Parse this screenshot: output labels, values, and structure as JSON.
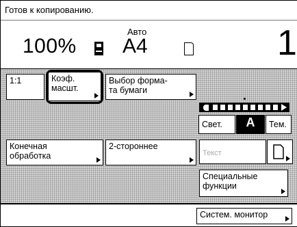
{
  "status": {
    "text": "Готов к копированию."
  },
  "header": {
    "zoom": "100%",
    "paper_mode": "Авто",
    "paper_size": "A4",
    "copies": "1"
  },
  "buttons": {
    "ratio_1to1": "1:1",
    "zoom_coef": "Коэф.\nмасшт.",
    "paper_select": "Выбор форма-\nта бумаги",
    "finishing": "Конечная\nобработка",
    "duplex": "2-стороннее",
    "special": "Специальные\nфункции",
    "sys_monitor": "Систем. монитор"
  },
  "density": {
    "light": "Свет.",
    "auto": "A",
    "dark": "Тем.",
    "level": 0.5
  },
  "image_mode": {
    "label": "Текст"
  },
  "icons": [
    "paper-cassette-icon",
    "original-document-icon",
    "arrow-right-icon",
    "density-bar-icon"
  ],
  "colors": {
    "hatch": "#d4d4d4",
    "text": "#000000"
  }
}
